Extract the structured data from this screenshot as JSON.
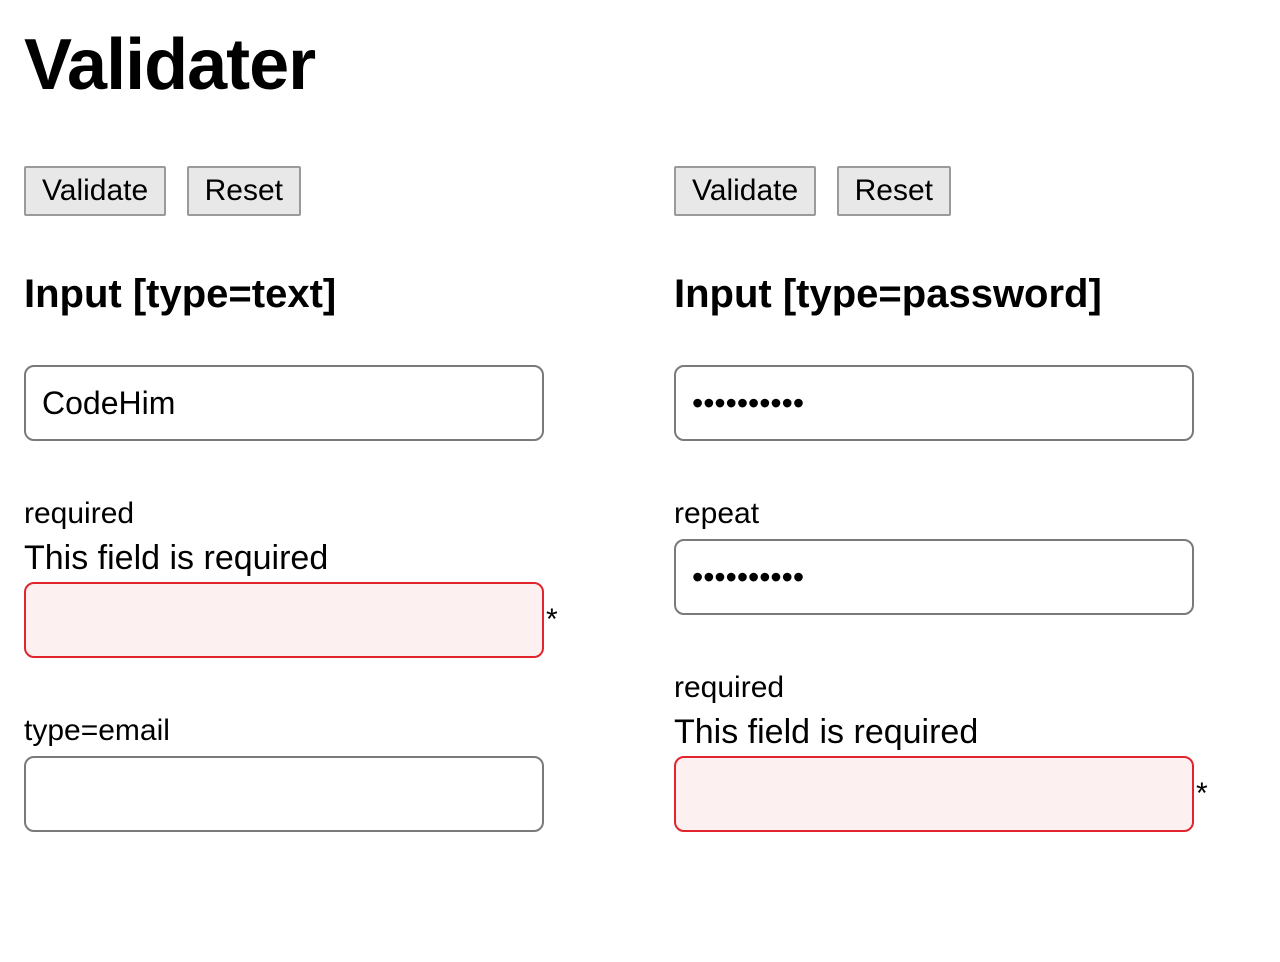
{
  "title": "Validater",
  "buttons": {
    "validate": "Validate",
    "reset": "Reset"
  },
  "left": {
    "heading": "Input [type=text]",
    "field1": {
      "value": "CodeHim"
    },
    "field2": {
      "label": "required",
      "error": "This field is required",
      "value": "",
      "star": "*"
    },
    "field3": {
      "label": "type=email",
      "value": ""
    }
  },
  "right": {
    "heading": "Input [type=password]",
    "field1": {
      "value": "••••••••••"
    },
    "field2": {
      "label": "repeat",
      "value": "••••••••••"
    },
    "field3": {
      "label": "required",
      "error": "This field is required",
      "value": "",
      "star": "*"
    }
  }
}
